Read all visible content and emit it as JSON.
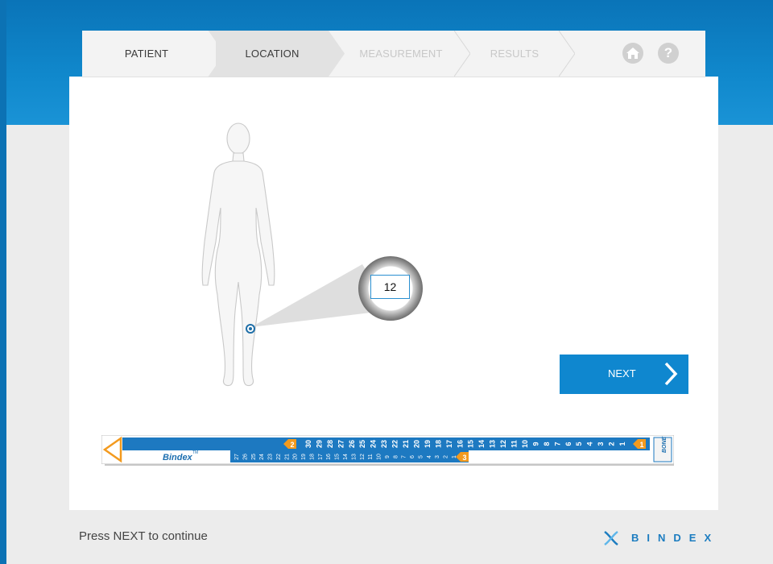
{
  "stepper": {
    "steps": [
      {
        "label": "PATIENT",
        "state": "done"
      },
      {
        "label": "LOCATION",
        "state": "active"
      },
      {
        "label": "MEASUREMENT",
        "state": "todo"
      },
      {
        "label": "RESULTS",
        "state": "todo"
      }
    ],
    "icons": {
      "home": "home-icon",
      "help": "help-icon"
    },
    "help_glyph": "?"
  },
  "measurement_site": {
    "value": "12",
    "body_icon": "female-body-figure"
  },
  "next_button": {
    "label": "NEXT",
    "icon": "chevron-right-icon"
  },
  "ruler": {
    "brand_label": "Bindex",
    "trademark": "TM",
    "side_label": "BONE",
    "top_scale": [
      "1",
      "2",
      "3",
      "4",
      "5",
      "6",
      "7",
      "8",
      "9",
      "10",
      "11",
      "12",
      "13",
      "14",
      "15",
      "16",
      "17",
      "18",
      "19",
      "20",
      "21",
      "22",
      "23",
      "24",
      "25",
      "26",
      "27",
      "28",
      "29",
      "30"
    ],
    "markers": [
      "1",
      "2",
      "3"
    ]
  },
  "footer": {
    "hint": "Press NEXT to continue",
    "brand": "BINDEX"
  },
  "colors": {
    "accent": "#0f87cf",
    "banner": "#0a74b8",
    "marker_orange": "#f39a1e"
  }
}
